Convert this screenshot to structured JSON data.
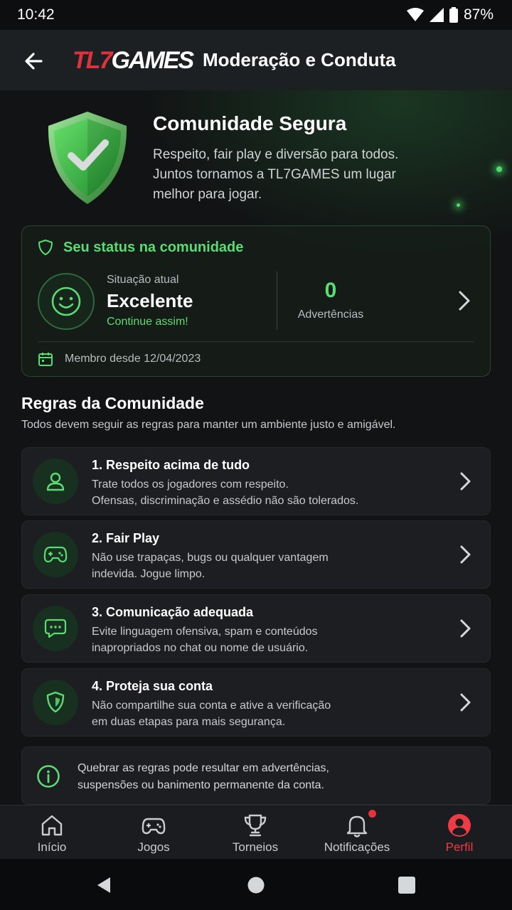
{
  "status_bar": {
    "time": "10:42",
    "battery": "87%",
    "icons": [
      "wifi-icon",
      "signal-icon",
      "battery-icon"
    ]
  },
  "app_bar": {
    "back_icon": "arrow-left-icon",
    "logo_part_red": "TL7",
    "logo_part_white": "GAMES",
    "title": "Moderação e Conduta"
  },
  "hero": {
    "icon": "shield-check-icon",
    "title": "Comunidade Segura",
    "subtitle": "Respeito, fair play e diversão para todos. Juntos tornamos a TL7GAMES um lugar melhor para jogar."
  },
  "status_card": {
    "title": "Seu status na comunidade",
    "situation_label": "Situação atual",
    "situation_value": "Excelente",
    "situation_cta": "Continue assim!",
    "warnings_count": "0",
    "warnings_label": "Advertências",
    "member_since": "Membro desde 12/04/2023"
  },
  "rules": {
    "title": "Regras da Comunidade",
    "subtitle": "Todos devem seguir as regras para manter um ambiente justo e amigável.",
    "items": [
      {
        "title": "1. Respeito acima de tudo",
        "desc_line1": "Trate todos os jogadores com respeito.",
        "desc_line2": "Ofensas, discriminação e assédio não são tolerados.",
        "icon": "user-icon"
      },
      {
        "title": "2. Fair Play",
        "desc_line1": "Não use trapaças, bugs ou qualquer vantagem",
        "desc_line2": "indevida. Jogue limpo.",
        "icon": "gamepad-icon"
      },
      {
        "title": "3. Comunicação adequada",
        "desc_line1": "Evite linguagem ofensiva, spam e conteúdos",
        "desc_line2": "inapropriados no chat ou nome de usuário.",
        "icon": "chat-icon"
      },
      {
        "title": "4. Proteja sua conta",
        "desc_line1": "Não compartilhe sua conta e ative a verificação",
        "desc_line2": "em duas etapas para mais segurança.",
        "icon": "shield-icon"
      }
    ]
  },
  "info": {
    "line1": "Quebrar as regras pode resultar em advertências,",
    "line2": "suspensões ou banimento permanente da conta."
  },
  "bottom_nav": [
    {
      "label": "Início",
      "icon": "home-icon"
    },
    {
      "label": "Jogos",
      "icon": "gamepad-icon"
    },
    {
      "label": "Torneios",
      "icon": "trophy-icon"
    },
    {
      "label": "Notificações",
      "icon": "bell-icon",
      "badge": true
    },
    {
      "label": "Perfil",
      "icon": "profile-icon",
      "active": true
    }
  ],
  "colors": {
    "accent_green": "#5bdc72",
    "brand_red": "#e0323a",
    "background": "#121314",
    "card": "#1c1e21"
  }
}
